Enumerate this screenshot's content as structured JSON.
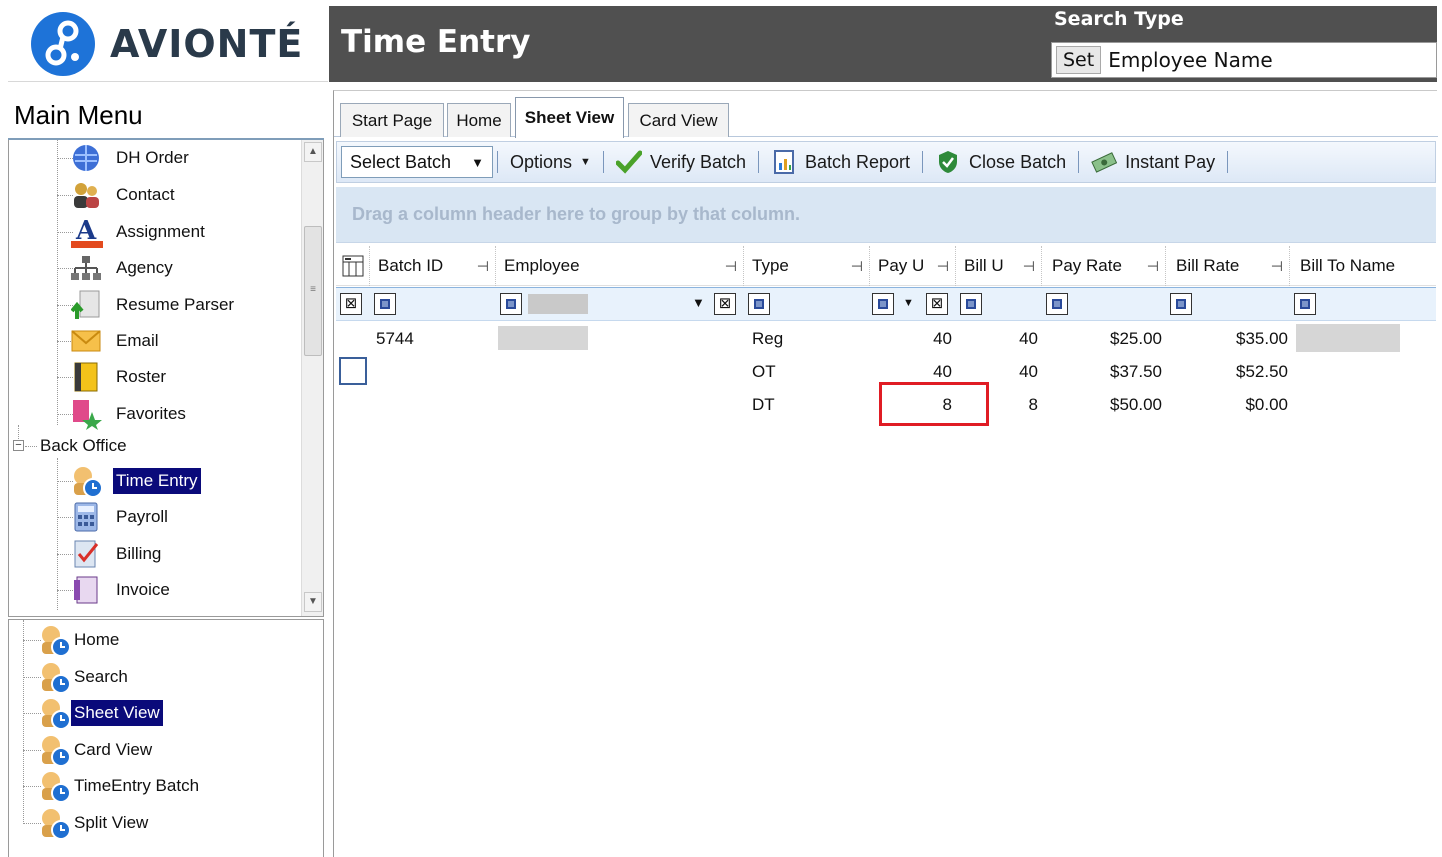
{
  "brand": {
    "name": "AVIONTÉ"
  },
  "header": {
    "title": "Time Entry",
    "search_type_label": "Search Type",
    "set_label": "Set",
    "search_value": "Employee Name"
  },
  "main_menu": {
    "title": "Main Menu",
    "items": [
      {
        "label": "DH Order",
        "icon": "globe-icon"
      },
      {
        "label": "Contact",
        "icon": "people-icon"
      },
      {
        "label": "Assignment",
        "icon": "letter-a-icon"
      },
      {
        "label": "Agency",
        "icon": "org-chart-icon"
      },
      {
        "label": "Resume Parser",
        "icon": "document-arrow-icon"
      },
      {
        "label": "Email",
        "icon": "envelope-icon"
      },
      {
        "label": "Roster",
        "icon": "roster-icon"
      },
      {
        "label": "Favorites",
        "icon": "favorites-icon"
      }
    ],
    "group": {
      "label": "Back Office",
      "expander": "−"
    },
    "group_items": [
      {
        "label": "Time Entry",
        "icon": "clock-icon",
        "selected": true
      },
      {
        "label": "Payroll",
        "icon": "calculator-icon"
      },
      {
        "label": "Billing",
        "icon": "billing-icon"
      },
      {
        "label": "Invoice",
        "icon": "invoice-icon"
      }
    ]
  },
  "sub_menu": {
    "items": [
      {
        "label": "Home"
      },
      {
        "label": "Search"
      },
      {
        "label": "Sheet View",
        "selected": true
      },
      {
        "label": "Card View"
      },
      {
        "label": "TimeEntry Batch"
      },
      {
        "label": "Split View"
      }
    ]
  },
  "tabs": [
    {
      "label": "Start Page"
    },
    {
      "label": "Home"
    },
    {
      "label": "Sheet View",
      "active": true
    },
    {
      "label": "Card View"
    }
  ],
  "toolbar": {
    "select_batch": "Select Batch",
    "options": "Options",
    "verify_batch": "Verify Batch",
    "batch_report": "Batch Report",
    "close_batch": "Close Batch",
    "instant_pay": "Instant Pay"
  },
  "group_hint": "Drag a column header here to group by that column.",
  "columns": [
    "Batch ID",
    "Employee",
    "Type",
    "Pay U",
    "Bill U",
    "Pay Rate",
    "Bill Rate",
    "Bill To Name"
  ],
  "rows": [
    {
      "batch_id": "5744",
      "type": "Reg",
      "pay_u": "40",
      "bill_u": "40",
      "pay_rate": "$25.00",
      "bill_rate": "$35.00"
    },
    {
      "batch_id": "",
      "type": "OT",
      "pay_u": "40",
      "bill_u": "40",
      "pay_rate": "$37.50",
      "bill_rate": "$52.50"
    },
    {
      "batch_id": "",
      "type": "DT",
      "pay_u": "8",
      "bill_u": "8",
      "pay_rate": "$50.00",
      "bill_rate": "$0.00"
    }
  ],
  "colors": {
    "header_bg": "#505050",
    "selected_bg": "#0a0a7a",
    "highlight": "#e01c24",
    "brand_blue": "#1e73d8"
  }
}
